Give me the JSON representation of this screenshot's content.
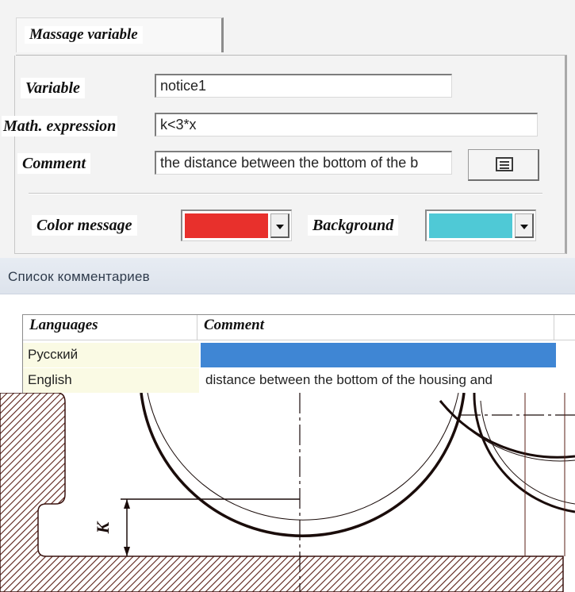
{
  "variable_dialog": {
    "tab_label": "Massage variable",
    "variable_label": "Variable",
    "variable_value": "notice1",
    "math_label": "Math. expression",
    "math_value": "k<3*x",
    "comment_label": "Comment",
    "comment_value": "the distance between the bottom of the b",
    "list_button_icon": "list-icon",
    "color_message_label": "Color message",
    "color_message_value": "#e8302c",
    "background_label": "Background",
    "background_value": "#4fc9d6"
  },
  "comments_list": {
    "title": "Список комментариев",
    "columns": [
      "Languages",
      "Comment"
    ],
    "rows": [
      {
        "language": "Русский",
        "comment": ""
      },
      {
        "language": "English",
        "comment": "distance between the bottom of the housing and"
      }
    ],
    "selected_row_color": "#3f86d4",
    "language_cell_color": "#fafae4"
  },
  "drawing": {
    "dimension_label": "K",
    "hatch_color": "#5a1f16"
  }
}
